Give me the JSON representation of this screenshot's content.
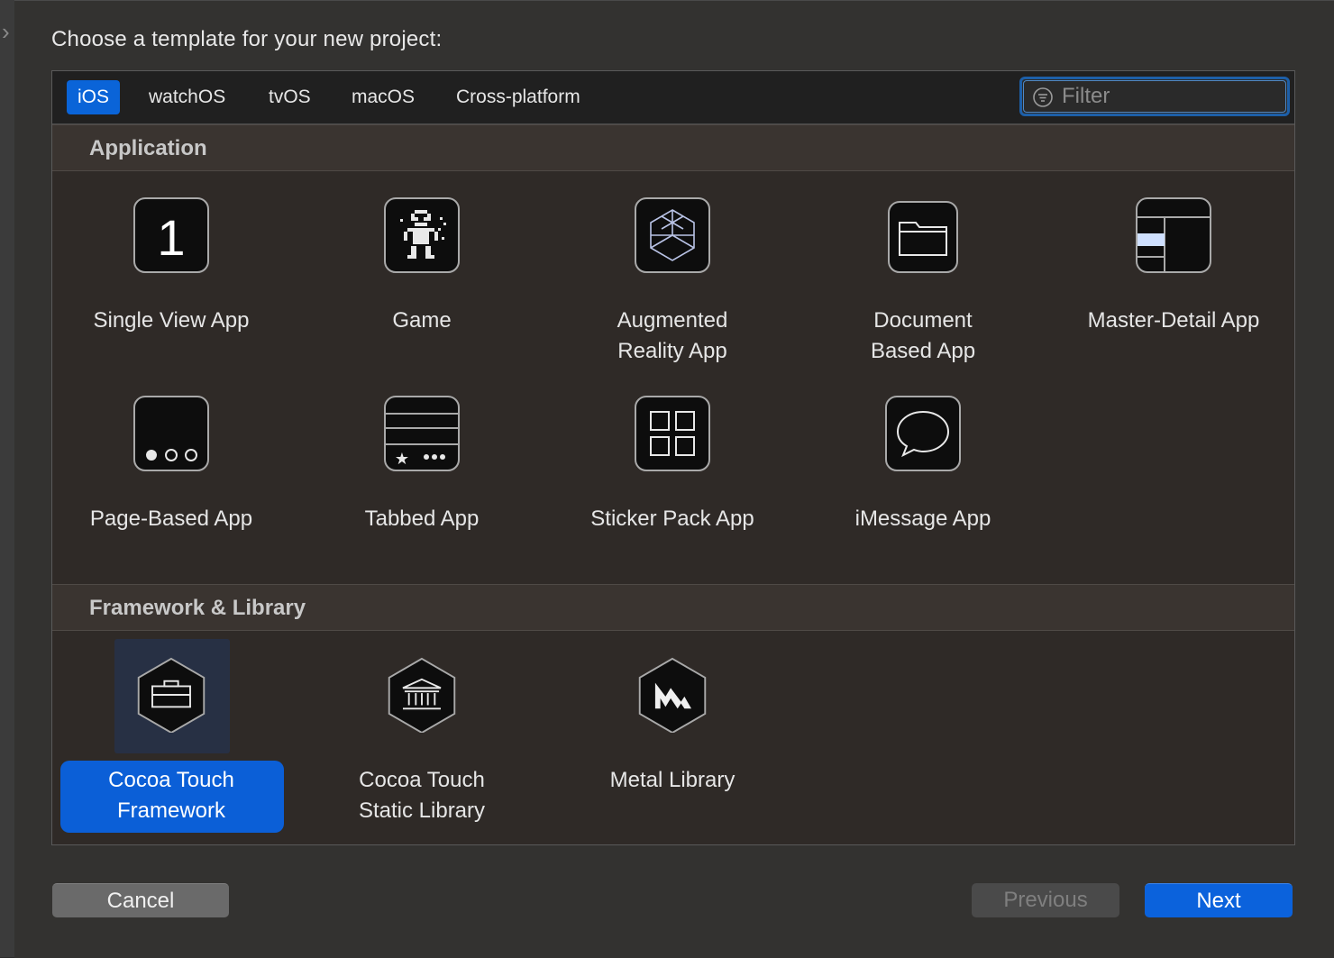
{
  "dialog": {
    "heading": "Choose a template for your new project:"
  },
  "platform_tabs": [
    {
      "label": "iOS",
      "active": true
    },
    {
      "label": "watchOS",
      "active": false
    },
    {
      "label": "tvOS",
      "active": false
    },
    {
      "label": "macOS",
      "active": false
    },
    {
      "label": "Cross-platform",
      "active": false
    }
  ],
  "filter": {
    "placeholder": "Filter",
    "value": ""
  },
  "sections": [
    {
      "title": "Application",
      "templates": [
        {
          "name": "Single View App",
          "lines": [
            "Single View App"
          ],
          "icon": "single-view-icon"
        },
        {
          "name": "Game",
          "lines": [
            "Game"
          ],
          "icon": "game-sprite-icon"
        },
        {
          "name": "Augmented Reality App",
          "lines": [
            "Augmented",
            "Reality App"
          ],
          "icon": "ar-cube-icon"
        },
        {
          "name": "Document Based App",
          "lines": [
            "Document",
            "Based App"
          ],
          "icon": "folder-icon"
        },
        {
          "name": "Master-Detail App",
          "lines": [
            "Master-Detail App"
          ],
          "icon": "split-view-icon"
        },
        {
          "name": "Page-Based App",
          "lines": [
            "Page-Based App"
          ],
          "icon": "page-dots-icon"
        },
        {
          "name": "Tabbed App",
          "lines": [
            "Tabbed App"
          ],
          "icon": "tab-bar-icon"
        },
        {
          "name": "Sticker Pack App",
          "lines": [
            "Sticker Pack App"
          ],
          "icon": "grid-icon"
        },
        {
          "name": "iMessage App",
          "lines": [
            "iMessage App"
          ],
          "icon": "speech-bubble-icon"
        }
      ]
    },
    {
      "title": "Framework & Library",
      "templates": [
        {
          "name": "Cocoa Touch Framework",
          "lines": [
            "Cocoa Touch",
            "Framework"
          ],
          "icon": "toolbox-icon",
          "selected": true
        },
        {
          "name": "Cocoa Touch Static Library",
          "lines": [
            "Cocoa Touch",
            "Static Library"
          ],
          "icon": "library-building-icon"
        },
        {
          "name": "Metal Library",
          "lines": [
            "Metal Library"
          ],
          "icon": "metal-logo-icon"
        }
      ]
    }
  ],
  "buttons": {
    "cancel": {
      "label": "Cancel",
      "enabled": true
    },
    "previous": {
      "label": "Previous",
      "enabled": false
    },
    "next": {
      "label": "Next",
      "enabled": true
    }
  },
  "colors": {
    "accent": "#0b62dc",
    "selection_bg": "#273044"
  }
}
